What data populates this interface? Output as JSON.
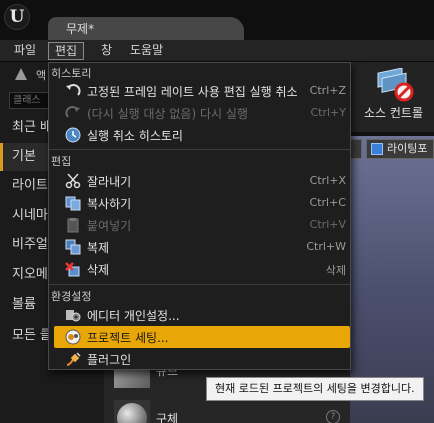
{
  "window": {
    "tab_title": "무제*"
  },
  "menubar": {
    "items": [
      "파일",
      "편집",
      "창",
      "도움말"
    ]
  },
  "left_panel": {
    "mode_label": "액",
    "search_placeholder": "클래스",
    "categories": [
      "최근 배",
      "기본",
      "라이트",
      "시네마",
      "비주얼",
      "지오메",
      "볼륨",
      "모든 클"
    ]
  },
  "toolbar": {
    "source_control_label": "소스 컨트롤"
  },
  "viewport": {
    "lighting_button": "라이팅포"
  },
  "dropdown": {
    "history_title": "히스토리",
    "undo": {
      "label": "고정된 프레임 레이트 사용 편집 실행 취소",
      "shortcut": "Ctrl+Z"
    },
    "redo": {
      "label": "(다시 실행 대상 없음) 다시 실행",
      "shortcut": "Ctrl+Y"
    },
    "undo_history": {
      "label": "실행 취소 히스토리"
    },
    "edit_title": "편집",
    "cut": {
      "label": "잘라내기",
      "shortcut": "Ctrl+X"
    },
    "copy": {
      "label": "복사하기",
      "shortcut": "Ctrl+C"
    },
    "paste": {
      "label": "붙여넣기",
      "shortcut": "Ctrl+V"
    },
    "duplicate": {
      "label": "복제",
      "shortcut": "Ctrl+W"
    },
    "delete": {
      "label": "삭제",
      "shortcut": "삭제"
    },
    "config_title": "환경설정",
    "editor_prefs": {
      "label": "에디터 개인설정..."
    },
    "project_settings": {
      "label": "프로젝트 세팅..."
    },
    "plugins": {
      "label": "플러그인"
    }
  },
  "place_list": {
    "items": [
      {
        "name": "큐브"
      },
      {
        "name": "구체"
      }
    ]
  },
  "tooltip": {
    "text": "현재 로드된 프로젝트의 세팅을 변경합니다."
  },
  "colors": {
    "highlight": "#e9a707",
    "selected_accent": "#d89b1c"
  }
}
